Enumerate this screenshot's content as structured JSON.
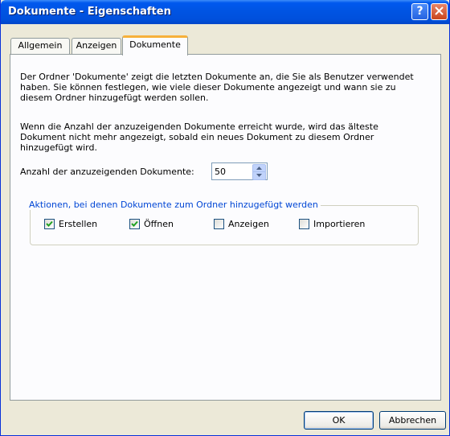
{
  "window": {
    "title": "Dokumente - Eigenschaften",
    "help_glyph": "?",
    "close_glyph": "X"
  },
  "tabs": [
    {
      "label": "Allgemein",
      "active": false
    },
    {
      "label": "Anzeigen",
      "active": false
    },
    {
      "label": "Dokumente",
      "active": true
    }
  ],
  "content": {
    "intro": "Der Ordner 'Dokumente' zeigt die letzten Dokumente an, die Sie als Benutzer verwendet haben. Sie können festlegen, wie viele dieser Dokumente angezeigt und wann sie zu diesem Ordner hinzugefügt werden sollen.",
    "limit_info": "Wenn die Anzahl der anzuzeigenden Dokumente erreicht wurde, wird das älteste Dokument nicht mehr angezeigt, sobald ein neues Dokument zu diesem Ordner hinzugefügt wird.",
    "count_label": "Anzahl der anzuzeigenden Dokumente:",
    "count_value": "50"
  },
  "actions_group": {
    "legend": "Aktionen, bei denen Dokumente zum Ordner hinzugefügt werden",
    "options": [
      {
        "label": "Erstellen",
        "checked": true
      },
      {
        "label": "Öffnen",
        "checked": true
      },
      {
        "label": "Anzeigen",
        "checked": false
      },
      {
        "label": "Importieren",
        "checked": false
      }
    ]
  },
  "buttons": {
    "ok": "OK",
    "cancel": "Abbrechen"
  },
  "colors": {
    "titlebar": "#0054e3",
    "dialog_bg": "#ece9d8",
    "panel_bg": "#fcfcfe",
    "active_tab_accent": "#f7b13b",
    "group_legend": "#0046d5",
    "checkmark": "#21a121"
  }
}
